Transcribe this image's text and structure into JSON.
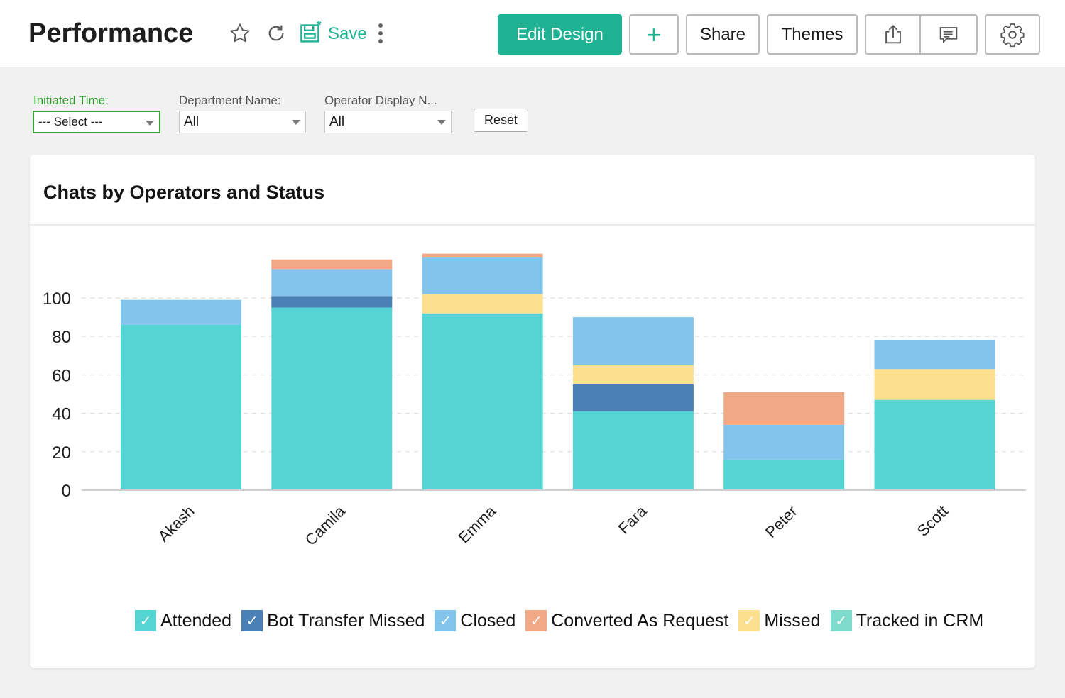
{
  "header": {
    "title": "Performance",
    "save_label": "Save",
    "edit_design_label": "Edit Design",
    "add_label": "+",
    "share_label": "Share",
    "themes_label": "Themes"
  },
  "filters": [
    {
      "label": "Initiated Time:",
      "value": "--- Select ---"
    },
    {
      "label": "Department Name:",
      "value": "All"
    },
    {
      "label": "Operator Display N...",
      "value": "All"
    }
  ],
  "reset_label": "Reset",
  "colors": {
    "accent": "#1fb394",
    "Attended": "#54d5d3",
    "Bot Transfer Missed": "#4a80b4",
    "Closed": "#82c4ec",
    "Converted As Request": "#f0a984",
    "Missed": "#fde08e",
    "Tracked in CRM": "#7fdccd"
  },
  "chart_data": {
    "type": "bar",
    "stacked": true,
    "title": "Chats by Operators and Status",
    "xlabel": "",
    "ylabel": "",
    "categories": [
      "Akash",
      "Camila",
      "Emma",
      "Fara",
      "Peter",
      "Scott"
    ],
    "series": [
      {
        "name": "Attended",
        "values": [
          86,
          95,
          92,
          41,
          16,
          47
        ]
      },
      {
        "name": "Bot Transfer Missed",
        "values": [
          0,
          6,
          0,
          14,
          0,
          0
        ]
      },
      {
        "name": "Missed",
        "values": [
          0,
          0,
          10,
          10,
          0,
          16
        ]
      },
      {
        "name": "Closed",
        "values": [
          13,
          14,
          19,
          25,
          18,
          15
        ]
      },
      {
        "name": "Converted As Request",
        "values": [
          0,
          5,
          2,
          0,
          17,
          0
        ]
      },
      {
        "name": "Tracked in CRM",
        "values": [
          0,
          0,
          0,
          0,
          0,
          0
        ]
      }
    ],
    "stack_order": [
      "Attended",
      "Bot Transfer Missed",
      "Missed",
      "Closed",
      "Converted As Request",
      "Tracked in CRM"
    ],
    "legend_order": [
      "Attended",
      "Bot Transfer Missed",
      "Closed",
      "Converted As Request",
      "Missed",
      "Tracked in CRM"
    ],
    "yticks": [
      0,
      20,
      40,
      60,
      80,
      100
    ],
    "ylim": [
      0,
      100
    ],
    "grid": true,
    "legend_position": "bottom"
  }
}
